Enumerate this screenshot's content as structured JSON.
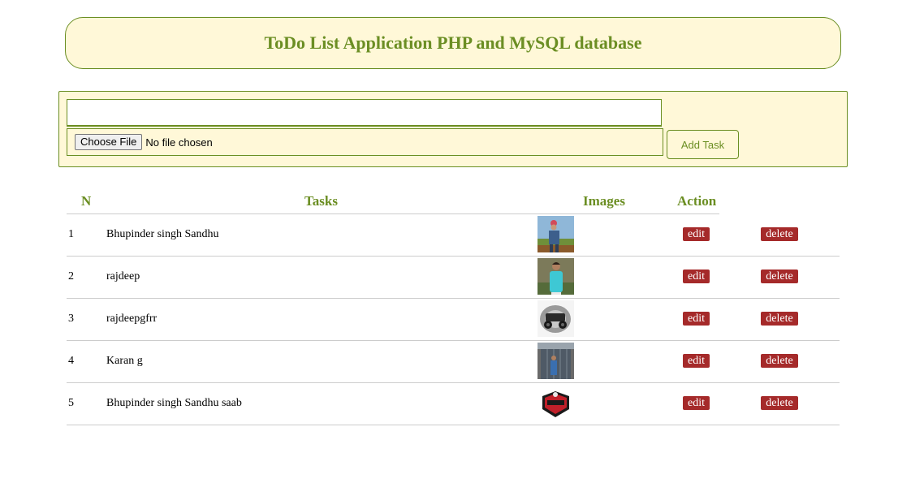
{
  "header": {
    "title": "ToDo List Application PHP and MySQL database"
  },
  "form": {
    "task_value": "",
    "file_button": "Choose File",
    "file_status": "No file chosen",
    "add_button": "Add Task"
  },
  "table": {
    "columns": [
      "N",
      "Tasks",
      "Images",
      "Action"
    ],
    "rows": [
      {
        "n": "1",
        "task": "Bhupinder singh Sandhu",
        "image": "photo-man-outdoors",
        "edit": "edit",
        "delete": "delete"
      },
      {
        "n": "2",
        "task": "rajdeep",
        "image": "photo-man-cyan-shirt",
        "edit": "edit",
        "delete": "delete"
      },
      {
        "n": "3",
        "task": "rajdeepgfrr",
        "image": "photo-offroad-vehicle",
        "edit": "edit",
        "delete": "delete"
      },
      {
        "n": "4",
        "task": "Karan g",
        "image": "photo-shed",
        "edit": "edit",
        "delete": "delete"
      },
      {
        "n": "5",
        "task": "Bhupinder singh Sandhu saab",
        "image": "logo-badge",
        "edit": "edit",
        "delete": "delete"
      }
    ]
  },
  "colors": {
    "accent": "#6b8e23",
    "panel_bg": "#fff8d8",
    "button_bg": "#a52a2a",
    "row_line": "#cccccc"
  }
}
